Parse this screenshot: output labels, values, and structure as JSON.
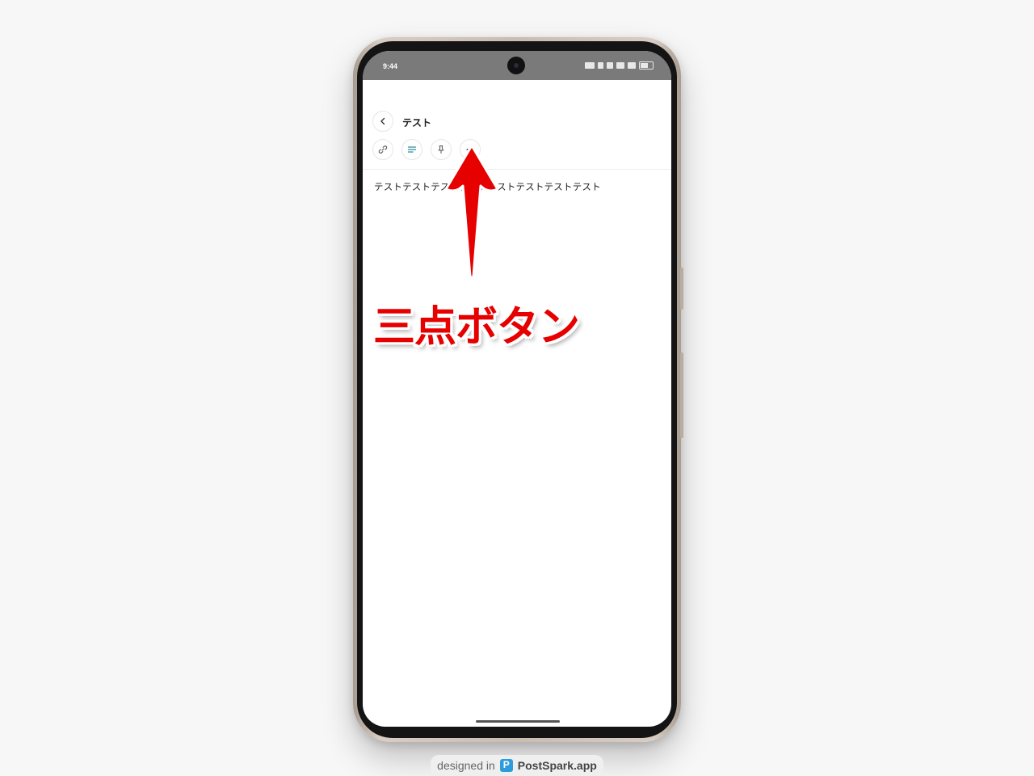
{
  "status_bar": {
    "time": "9:44"
  },
  "header": {
    "title": "テスト"
  },
  "toolbar": {
    "buttons": [
      "link-icon",
      "align-icon",
      "pin-icon",
      "more-icon"
    ]
  },
  "note": {
    "body": "テストテストテストテストテストテストテストテスト"
  },
  "annotation": {
    "label": "三点ボタン",
    "color": "#e60000"
  },
  "footer": {
    "prefix": "designed in",
    "brand": "PostSpark.app"
  }
}
